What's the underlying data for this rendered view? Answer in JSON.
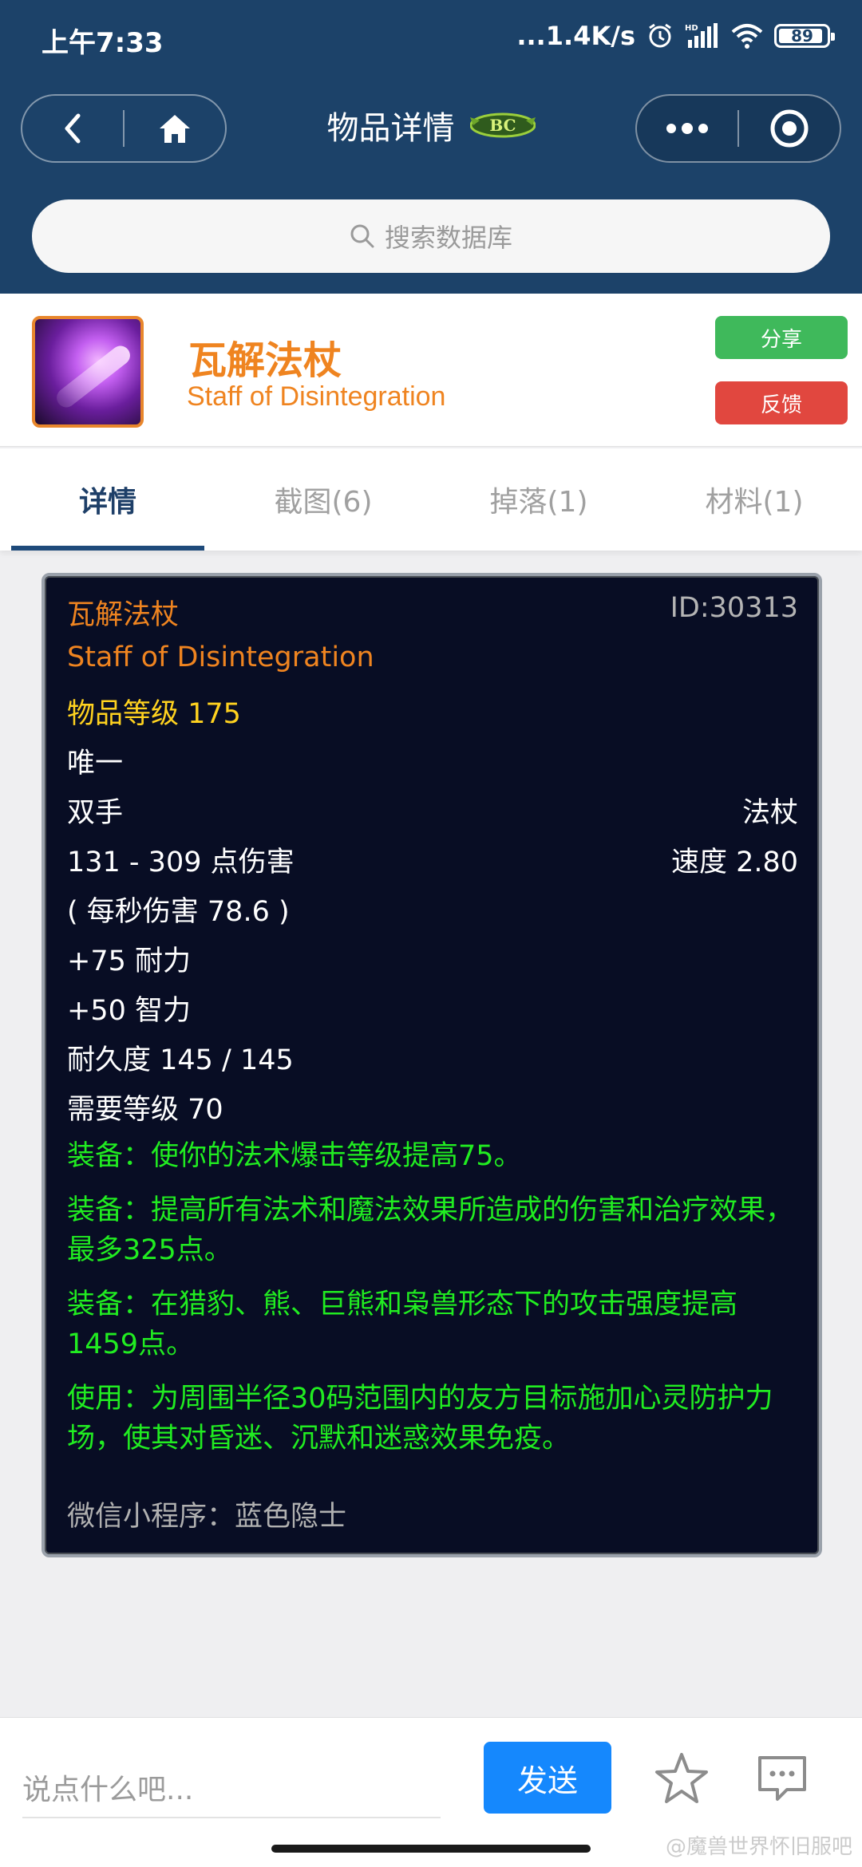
{
  "status_bar": {
    "time": "上午7:33",
    "network_speed": "...1.4K/s",
    "battery": "89",
    "icons": [
      "alarm-icon",
      "hd-signal-icon",
      "wifi-icon",
      "battery-icon"
    ]
  },
  "nav": {
    "title": "物品详情",
    "logo_text": "BC"
  },
  "search": {
    "placeholder": "搜索数据库"
  },
  "item": {
    "name_cn": "瓦解法杖",
    "name_en": "Staff of Disintegration",
    "share_label": "分享",
    "feedback_label": "反馈"
  },
  "tabs": [
    {
      "label": "详情",
      "active": true
    },
    {
      "label": "截图(6)",
      "active": false
    },
    {
      "label": "掉落(1)",
      "active": false
    },
    {
      "label": "材料(1)",
      "active": false
    }
  ],
  "tooltip": {
    "name_cn": "瓦解法杖",
    "id": "ID:30313",
    "name_en": "Staff of Disintegration",
    "item_level": "物品等级 175",
    "unique": "唯一",
    "slot": "双手",
    "type": "法杖",
    "damage": "131 - 309 点伤害",
    "speed": "速度 2.80",
    "dps": "( 每秒伤害 78.6 )",
    "stamina": "+75 耐力",
    "intellect": "+50 智力",
    "durability": "耐久度 145 / 145",
    "required_level": "需要等级 70",
    "effects": [
      "装备：使你的法术爆击等级提高75。",
      "装备：提高所有法术和魔法效果所造成的伤害和治疗效果，最多325点。",
      "装备：在猎豹、熊、巨熊和枭兽形态下的攻击强度提高1459点。",
      "使用：为周围半径30码范围内的友方目标施加心灵防护力场，使其对昏迷、沉默和迷惑效果免疫。"
    ],
    "footer": "微信小程序：蓝色隐士"
  },
  "bottom": {
    "comment_placeholder": "说点什么吧...",
    "send_label": "发送"
  },
  "watermark": "@魔兽世界怀旧服吧",
  "colors": {
    "header_bg": "#1c4269",
    "item_orange": "#ef8420",
    "tooltip_bg": "#080d24",
    "effect_green": "#21ec21",
    "share_green": "#3fb95b",
    "feedback_red": "#e1473f",
    "send_blue": "#1588fd"
  }
}
